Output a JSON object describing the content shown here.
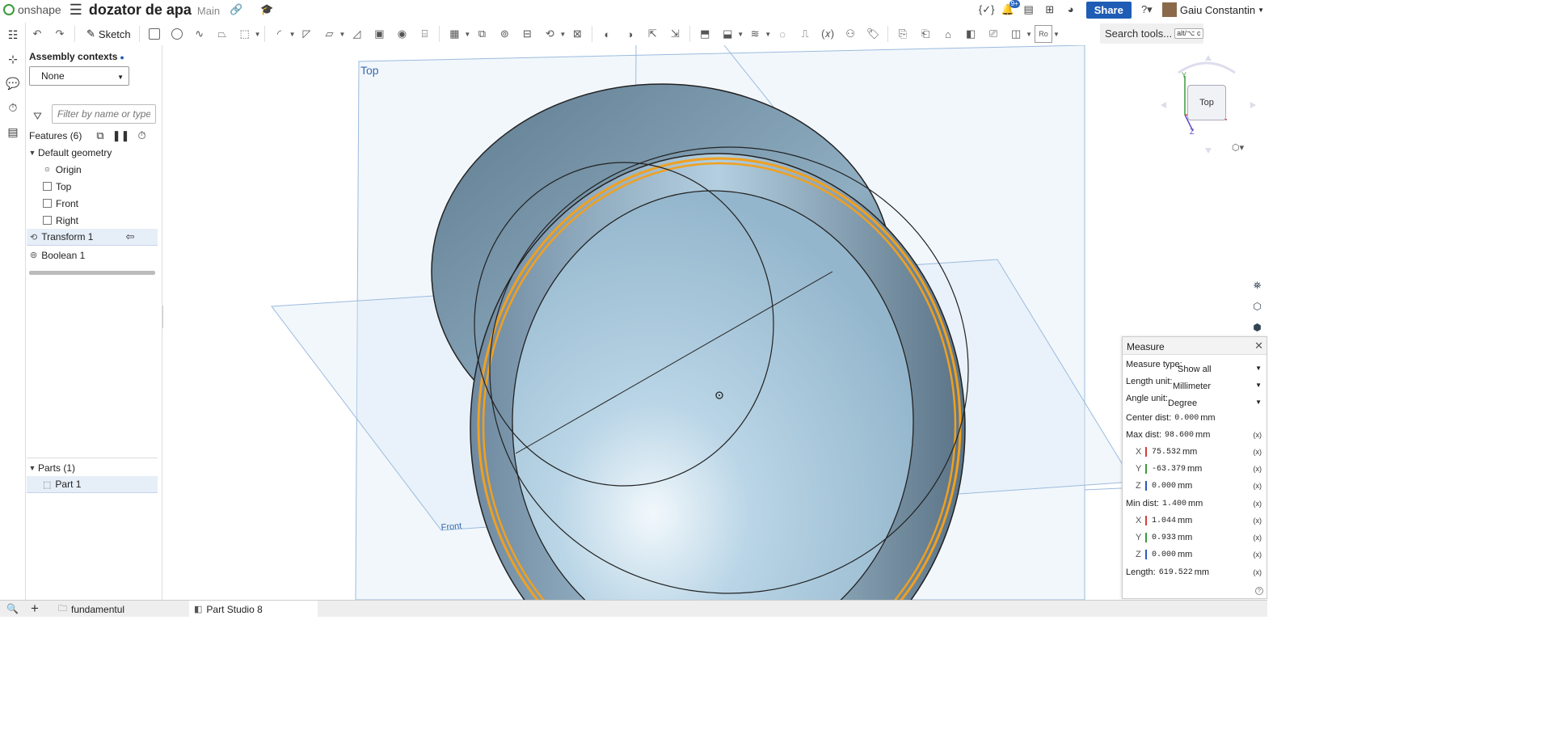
{
  "app": {
    "logo": "onshape",
    "doc_title": "dozator de apa",
    "branch": "Main",
    "notif_count": "9+",
    "share": "Share",
    "user": "Gaiu Constantin"
  },
  "toolbar": {
    "sketch": "Sketch",
    "search": "Search tools...",
    "search_kbd": "alt/⌥ c",
    "ro": "Ro"
  },
  "panel": {
    "assembly_contexts": "Assembly contexts",
    "context_value": "None",
    "filter_placeholder": "Filter by name or type",
    "features_label": "Features (6)",
    "default_geometry": "Default geometry",
    "items": [
      {
        "label": "Origin"
      },
      {
        "label": "Top"
      },
      {
        "label": "Front"
      },
      {
        "label": "Right"
      }
    ],
    "features": [
      {
        "label": "Transform 1"
      },
      {
        "label": "Boolean 1"
      }
    ],
    "parts_label": "Parts (1)",
    "part": "Part 1"
  },
  "viewport": {
    "plane_top": "Top",
    "plane_front": "Front",
    "cube_face": "Top",
    "axis_y": "Y",
    "axis_z": "Z"
  },
  "measure": {
    "title": "Measure",
    "type_label": "Measure type:",
    "type_value": "Show all",
    "length_label": "Length unit:",
    "length_value": "Millimeter",
    "angle_label": "Angle unit:",
    "angle_value": "Degree",
    "center_label": "Center dist:",
    "center_value": "0.000",
    "max_label": "Max dist:",
    "max_value": "98.600",
    "max_x": "75.532",
    "max_y": "-63.379",
    "max_z": "0.000",
    "min_label": "Min dist:",
    "min_value": "1.400",
    "min_x": "1.044",
    "min_y": "0.933",
    "min_z": "0.000",
    "length_res_label": "Length:",
    "length_res_value": "619.522",
    "unit": "mm",
    "fx": "(x)",
    "x": "X",
    "y": "Y",
    "z": "Z"
  },
  "tabs": {
    "folder": "fundamentul",
    "studio": "Part Studio 8"
  },
  "colors": {
    "accent": "#1f5cb5",
    "highlight": "#f0a020",
    "part": "#9fc3d9",
    "plane": "#9bbbdd"
  }
}
